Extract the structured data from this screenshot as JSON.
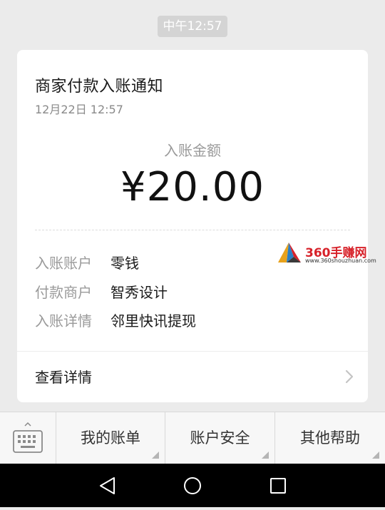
{
  "chat": {
    "timestamp": "中午12:57"
  },
  "card": {
    "title": "商家付款入账通知",
    "date": "12月22日  12:57",
    "amount_label": "入账金额",
    "amount": "¥20.00",
    "details": [
      {
        "key": "入账账户",
        "value": "零钱"
      },
      {
        "key": "付款商户",
        "value": "智秀设计"
      },
      {
        "key": "入账详情",
        "value": "邻里快讯提现"
      }
    ],
    "view_details_label": "查看详情"
  },
  "watermark": {
    "name": "360手赚网",
    "url": "www.360shouzhuan.com"
  },
  "bottom_menu": {
    "keyboard_icon": "keyboard-icon",
    "items": [
      {
        "label": "我的账单"
      },
      {
        "label": "账户安全"
      },
      {
        "label": "其他帮助"
      }
    ]
  },
  "nav": {
    "icons": [
      "back-icon",
      "home-icon",
      "recents-icon"
    ]
  },
  "colors": {
    "background": "#ebebeb",
    "card": "#ffffff",
    "muted_text": "#9a9a9a",
    "watermark_red": "#d7222a"
  }
}
